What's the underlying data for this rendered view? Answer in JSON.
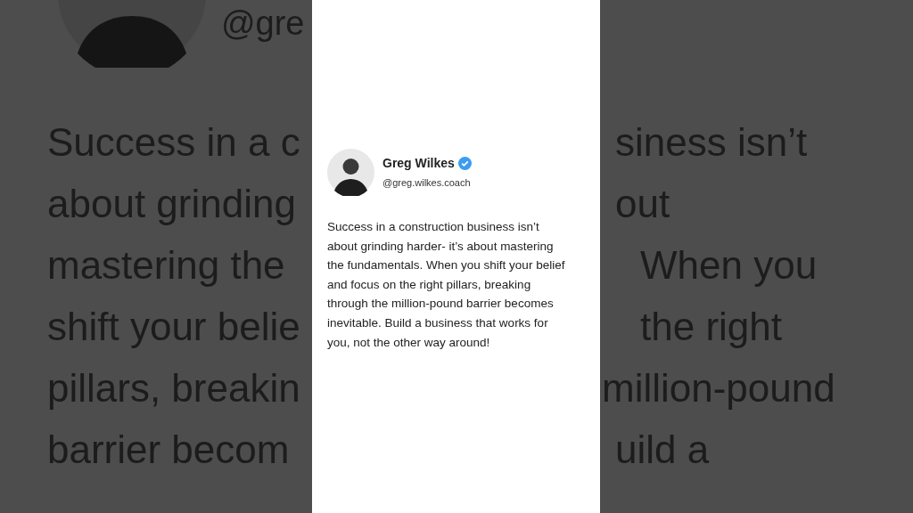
{
  "backdrop": {
    "handle": "@gre",
    "lines": [
      {
        "left": "Success in a c",
        "right": "siness isn’t"
      },
      {
        "left": "about grinding",
        "right": "out"
      },
      {
        "left": "mastering the",
        "right": "When you"
      },
      {
        "left": "shift your belie",
        "right": "the right"
      },
      {
        "left": "pillars, breakin",
        "right": "million-pound"
      },
      {
        "left": "barrier becom",
        "right": "uild a"
      }
    ]
  },
  "post": {
    "author": {
      "name": "Greg Wilkes",
      "verified": true,
      "handle": "@greg.wilkes.coach"
    },
    "text": "Success in a construction business isn’t about grinding harder- it’s about mastering the fundamentals. When you shift your belief and focus on the right pillars, breaking through the million-pound barrier becomes inevitable. Build a business that works for you, not the other way around!"
  }
}
